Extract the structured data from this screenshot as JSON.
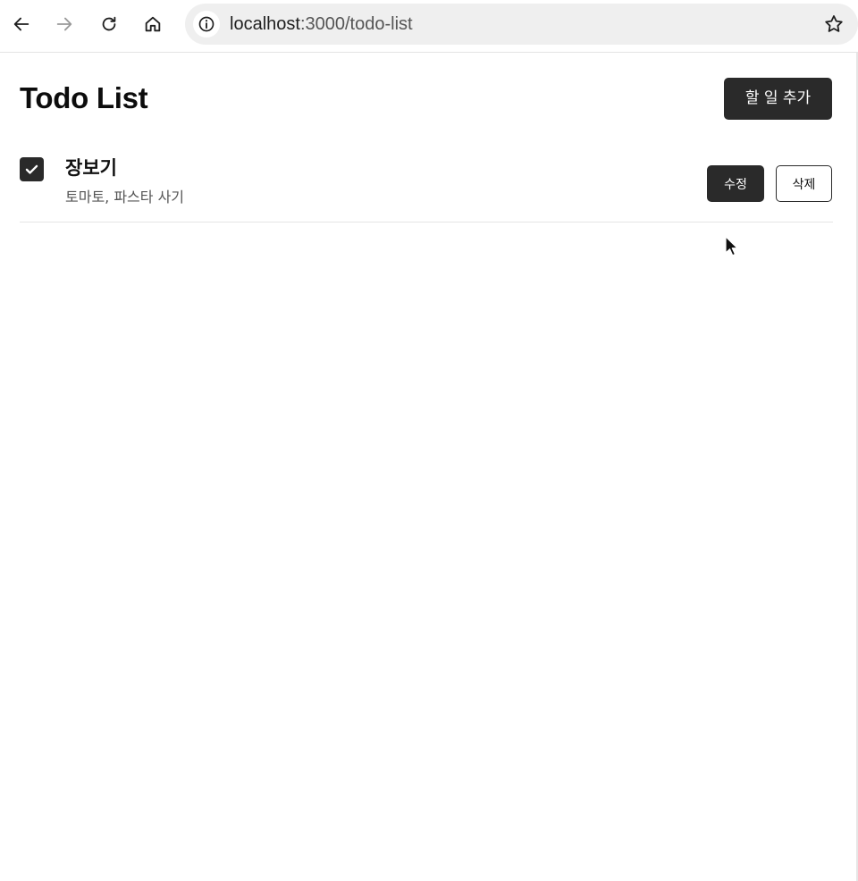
{
  "browser": {
    "url_host": "localhost",
    "url_path": ":3000/todo-list",
    "icons": {
      "back": "arrow-left-icon",
      "forward": "arrow-right-icon",
      "reload": "reload-icon",
      "home": "home-icon",
      "info": "info-icon",
      "bookmark": "star-icon"
    }
  },
  "header": {
    "title": "Todo List",
    "add_button_label": "할 일 추가"
  },
  "todos": [
    {
      "title": "장보기",
      "description": "토마토, 파스타 사기",
      "completed": true,
      "edit_label": "수정",
      "delete_label": "삭제"
    }
  ],
  "colors": {
    "primary_dark": "#2a2a2a",
    "background": "#ffffff",
    "muted_text": "#555555"
  }
}
